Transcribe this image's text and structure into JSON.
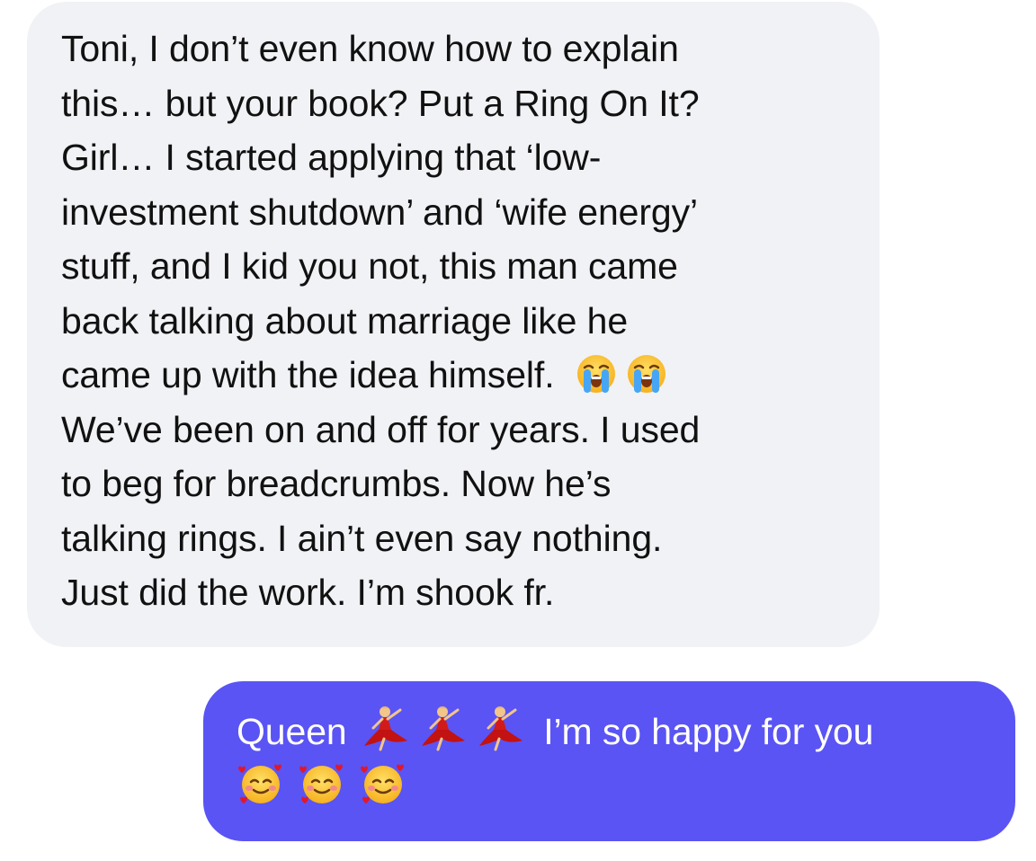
{
  "conversation": {
    "incoming_message": {
      "lines": [
        "Toni, I don’t even know how to explain",
        "this… but your book? Put a Ring On It?",
        "Girl… I started applying that ‘low-",
        "investment shutdown’ and ‘wife energy’",
        "stuff, and I kid you not, this man came",
        "back talking about marriage like he",
        "came up with the idea himself.",
        "We’ve been on and off for years. I used",
        "to beg for breadcrumbs. Now he’s",
        "talking rings. I ain’t even say nothing.",
        "Just did the work. I’m shook fr."
      ],
      "inline_emojis": [
        "loudly-crying-face-emoji",
        "loudly-crying-face-emoji"
      ]
    },
    "outgoing_message": {
      "prefix": "Queen",
      "suffix": "I’m so happy for you",
      "inline_emojis": [
        "woman-dancing-emoji",
        "woman-dancing-emoji",
        "woman-dancing-emoji"
      ],
      "trailing_emojis": [
        "smiling-face-with-hearts-emoji",
        "smiling-face-with-hearts-emoji",
        "smiling-face-with-hearts-emoji"
      ]
    }
  },
  "colors": {
    "incoming_bubble": "#f1f2f5",
    "outgoing_bubble": "#5a54f4",
    "incoming_text": "#111111",
    "outgoing_text": "#ffffff"
  }
}
